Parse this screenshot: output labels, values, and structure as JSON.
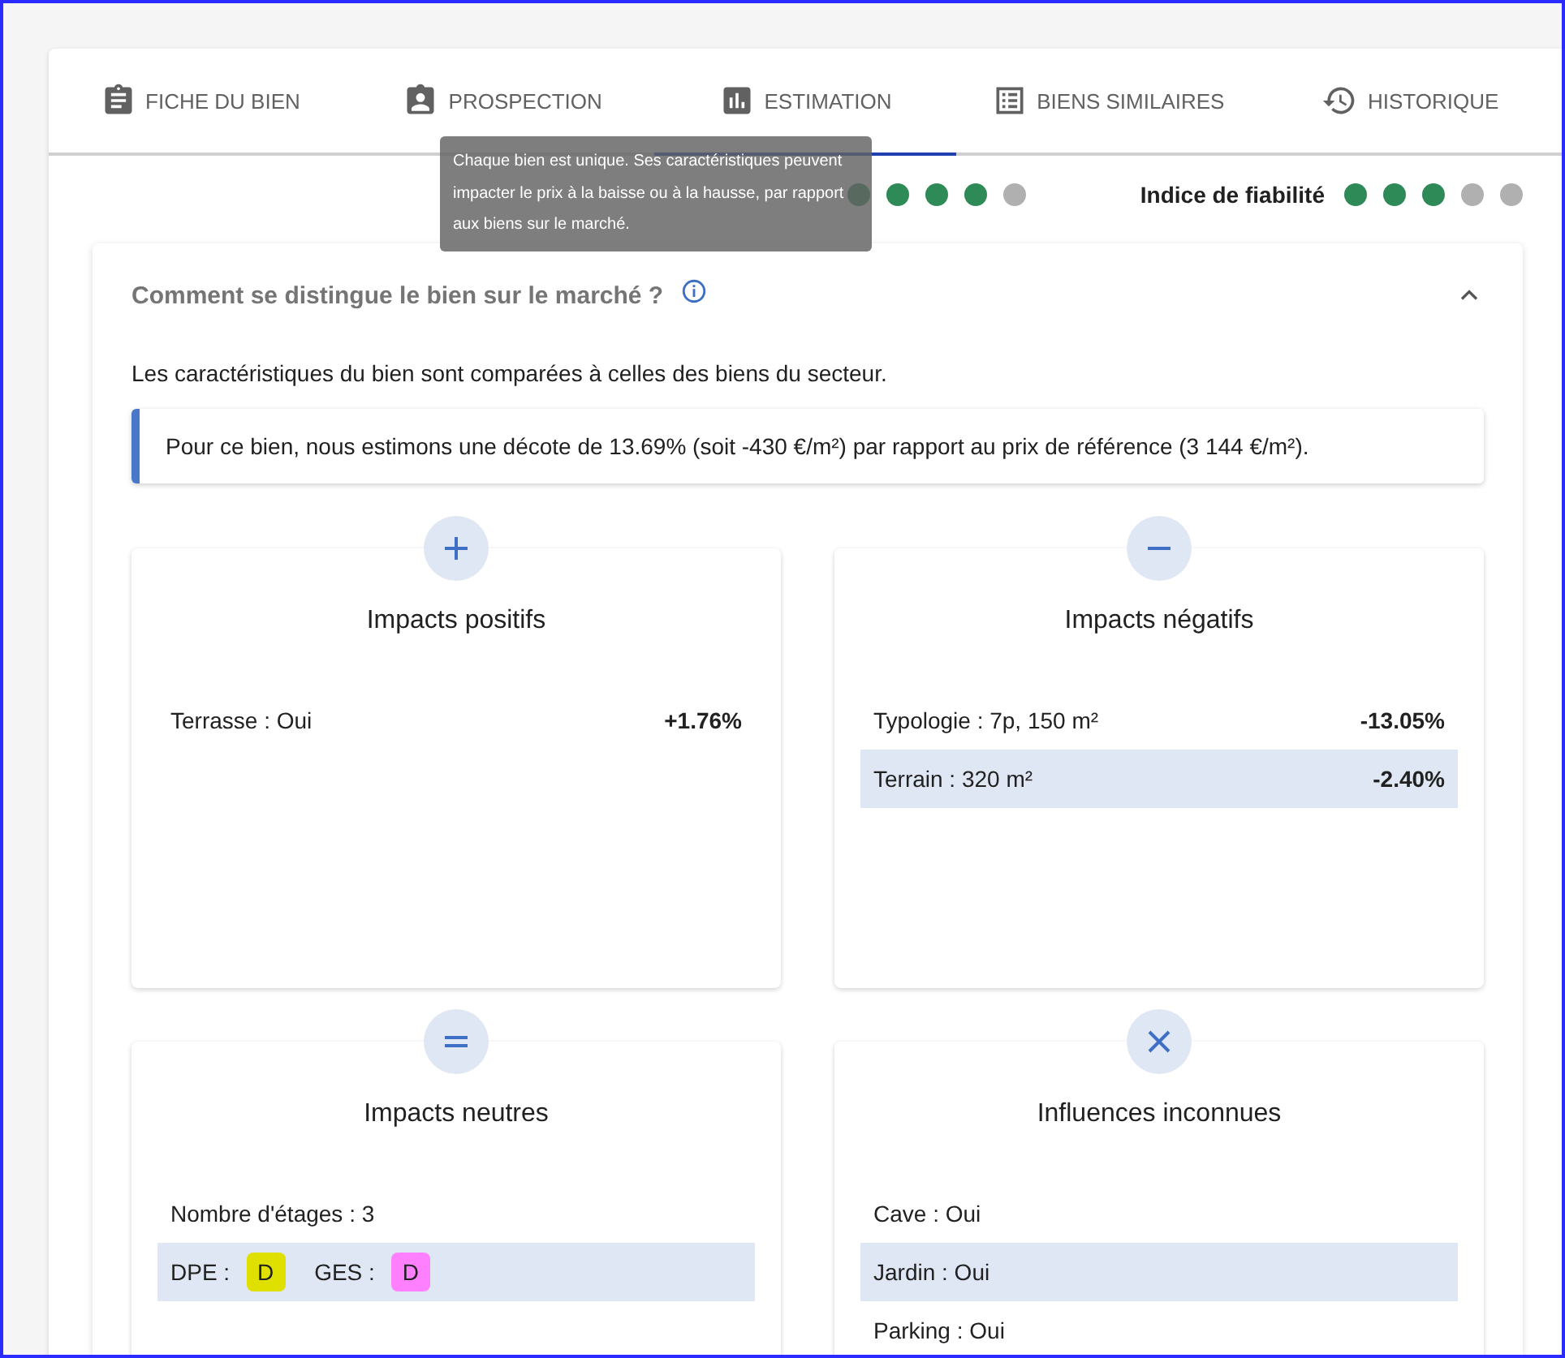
{
  "tabs": [
    {
      "label": "FICHE DU BIEN",
      "selected": false
    },
    {
      "label": "PROSPECTION",
      "selected": false
    },
    {
      "label": "ESTIMATION",
      "selected": true
    },
    {
      "label": "BIENS SIMILAIRES",
      "selected": false
    },
    {
      "label": "HISTORIQUE",
      "selected": false
    }
  ],
  "tooltip": "Chaque bien est unique. Ses caractéristiques peuvent impacter le prix à la baisse ou à la hausse, par rapport aux biens sur le marché.",
  "estimation_reliability": {
    "dots": [
      {
        "filled": true
      },
      {
        "filled": true
      },
      {
        "filled": true
      },
      {
        "filled": true
      },
      {
        "filled": false
      }
    ]
  },
  "reliability_index": {
    "label": "Indice de fiabilité",
    "dots": [
      {
        "filled": true
      },
      {
        "filled": true
      },
      {
        "filled": true
      },
      {
        "filled": false
      },
      {
        "filled": false
      }
    ]
  },
  "section": {
    "title": "Comment se distingue le bien sur le marché ?",
    "expanded": true,
    "intro": "Les caractéristiques du bien sont comparées à celles des biens du secteur.",
    "callout": "Pour ce bien, nous estimons une décote de 13.69% (soit -430 €/m²) par rapport au prix de référence (3 144 €/m²).",
    "groups": [
      {
        "kind": "plus",
        "title": "Impacts positifs",
        "rows": [
          {
            "label": "Terrasse : Oui",
            "value": "+1.76%",
            "highlighted": false
          }
        ]
      },
      {
        "kind": "minus",
        "title": "Impacts négatifs",
        "rows": [
          {
            "label": "Typologie : 7p, 150 m²",
            "value": "-13.05%",
            "highlighted": false
          },
          {
            "label": "Terrain : 320 m²",
            "value": "-2.40%",
            "highlighted": true
          }
        ]
      },
      {
        "kind": "equal",
        "title": "Impacts neutres",
        "rows": [
          {
            "label": "Nombre d'étages : 3",
            "highlighted": false
          },
          {
            "badges": [
              {
                "label": "DPE :",
                "grade": "D",
                "color": "#e0e000"
              },
              {
                "label": "GES :",
                "grade": "D",
                "color": "#ff80ff"
              }
            ],
            "highlighted": true
          }
        ]
      },
      {
        "kind": "cross",
        "title": "Influences inconnues",
        "rows": [
          {
            "label": "Cave : Oui",
            "highlighted": false
          },
          {
            "label": "Jardin : Oui",
            "highlighted": true
          },
          {
            "label": "Parking : Oui",
            "highlighted": false
          }
        ]
      }
    ]
  }
}
